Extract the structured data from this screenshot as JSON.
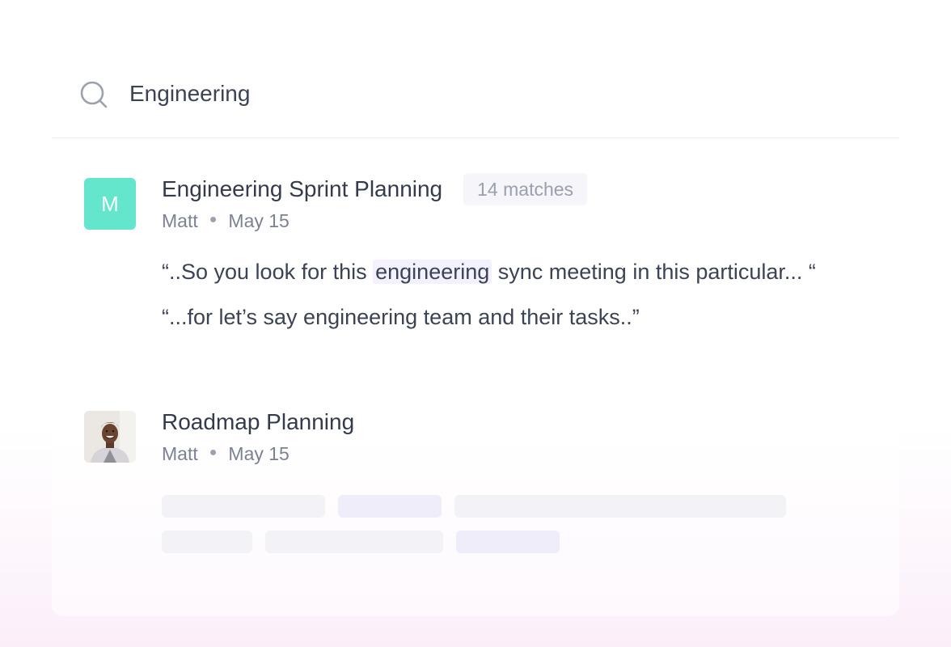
{
  "search": {
    "value": "Engineering",
    "icon": "search-icon"
  },
  "results": [
    {
      "avatar_letter": "M",
      "avatar_color": "#63e6cc",
      "title": "Engineering Sprint Planning",
      "badge": "14 matches",
      "author": "Matt",
      "date": "May 15",
      "snippets": [
        {
          "before": "“..So you look for this ",
          "highlight": "engineering",
          "after": " sync meeting in this particular... “"
        },
        {
          "text": "“...for let’s say engineering team and their tasks..”"
        }
      ]
    },
    {
      "avatar_icon": "user-photo-avatar",
      "title": "Roadmap Planning",
      "author": "Matt",
      "date": "May 15",
      "loading": true
    }
  ],
  "colors": {
    "text_primary": "#343b4c",
    "text_secondary": "#7b8292",
    "highlight_bg": "#f3f1ff",
    "badge_bg": "#f5f5fa",
    "divider": "#eceef3"
  }
}
